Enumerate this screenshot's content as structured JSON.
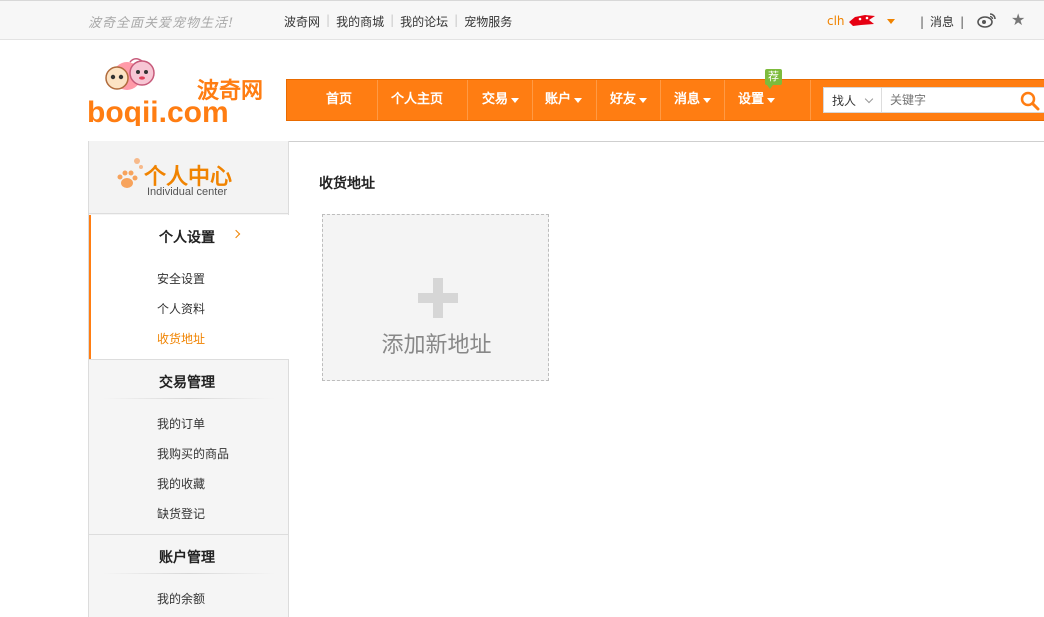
{
  "topbar": {
    "slogan": "波奇全面关爱宠物生活!",
    "links": [
      "波奇网",
      "我的商城",
      "我的论坛",
      "宠物服务"
    ],
    "username": "clh",
    "messages_label": "消息"
  },
  "logo": {
    "cn_text": "波奇网",
    "en_text": "boqii.com"
  },
  "nav": {
    "items": [
      {
        "label": "首页",
        "dropdown": false
      },
      {
        "label": "个人主页",
        "dropdown": false
      },
      {
        "label": "交易",
        "dropdown": true
      },
      {
        "label": "账户",
        "dropdown": true
      },
      {
        "label": "好友",
        "dropdown": true
      },
      {
        "label": "消息",
        "dropdown": true
      },
      {
        "label": "设置",
        "dropdown": true
      }
    ],
    "badge": "荐",
    "search_type": "找人",
    "search_placeholder": "关键字"
  },
  "sidebar": {
    "title": "个人中心",
    "subtitle": "Individual center",
    "sections": [
      {
        "title": "个人设置",
        "items": [
          "安全设置",
          "个人资料",
          "收货地址"
        ],
        "active_item": "收货地址"
      },
      {
        "title": "交易管理",
        "items": [
          "我的订单",
          "我购买的商品",
          "我的收藏",
          "缺货登记"
        ]
      },
      {
        "title": "账户管理",
        "items": [
          "我的余额"
        ]
      }
    ]
  },
  "main": {
    "title": "收货地址",
    "add_label": "添加新地址"
  },
  "colors": {
    "accent": "#ff7d12",
    "accent_text": "#f08300",
    "badge": "#7dbb3c"
  }
}
